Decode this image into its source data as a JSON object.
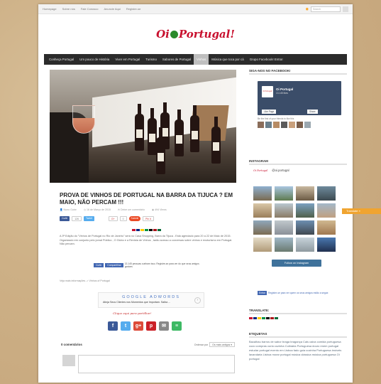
{
  "topbar": {
    "links": [
      "Homepage",
      "Sobre nós",
      "Fale Conosco",
      "Anuncie Aqui",
      "Registre-se"
    ],
    "search_placeholder": "Search"
  },
  "logo": {
    "text_left": "Oi",
    "text_right": "Portugal!"
  },
  "nav": {
    "items": [
      "Conheça Portugal",
      "Um pouco de História",
      "Viver em Portugal",
      "Turismo",
      "Sabores de Portugal",
      "Vinhos",
      "Música que toca por cá",
      "Grupo Facebook! Entra!"
    ],
    "active_index": 5
  },
  "article": {
    "title": "Prova de Vinhos de Portugal na Barra da Tijuca ? Em maio, não percam !!!",
    "author": "Nuno Gobe",
    "date": "16 de Março de 2015",
    "comments_link": "Deixe um comentário",
    "views": "494 Views",
    "share": {
      "fb": "Curtir",
      "fb_count": "126",
      "tweet": "Tweet",
      "gplus": "G+",
      "gplus_count": "0",
      "submit": "Submit",
      "pin": "Pin it"
    },
    "body": "A 3ª Edição do \"Vinhos de Portugal no Rio de Janeiro\" será no Casa Shopping, Barra da Tijuca - Está agendado para 20 a 22 de Maio de 2015. Organizado em conjunto pelo jornal Público , O Globo e a Revista de Vinhos , tarão acesso a conversas sobre vinhos e enoturismo em Portugal. Não percam.",
    "like_box": {
      "curtir": "Curtir",
      "compartilhar": "Compartilhar",
      "text": "13.145 pessoas curtiram isso. Registre-se para ver do que seus amigos gostam."
    },
    "see_more": "Veja mais informações -> Vinhos of Portugal",
    "ad": {
      "header": "GOOGLE ADWORDS",
      "text": "Atinja Seus Clientes nos Momentos que Importam. Saiba ..."
    },
    "share_hint": "Clique aqui para partilhar!",
    "comments": {
      "count": "0 comentários",
      "order_label": "Ordenar por",
      "order_value": "Os mais antigos"
    }
  },
  "sidebar": {
    "facebook": {
      "title": "Siga-nos no Facebook!",
      "page_name": "Oi Portugal",
      "likes": "13.145 likes",
      "like_page": "Like Page",
      "share": "Share",
      "friends_text": "Be the first of your friends to like this",
      "pic_text": "Oi Portugal!"
    },
    "instagram": {
      "title": "Instagram",
      "handle": "@oi.portugal",
      "logo": "Oi Portugal",
      "follow": "Follow on Instagram"
    },
    "fb_login": {
      "button": "Entrar",
      "text": "Registre-se para ver quem os seus amigos estão a seguir."
    },
    "translate": {
      "title": "Translate:"
    },
    "tags": {
      "title": "Etiquetas",
      "text": "Bacalhau barros de sabor braga bragança Cais caixa comida portuguesa cozo compras curia cozinha Culinária Portuguesa douro enem portugal estudar portugal evento em Lisboa fado guia cozinha Portuguesa imóveis lavandaria Lisboa morar portugal música clássica música portuguesa Oi portugal"
    }
  },
  "translate_tab": "Translate »",
  "colors": {
    "nav_bg": "#2b2b2b",
    "accent_red": "#c8102e",
    "facebook_blue": "#3b5998",
    "instagram_blue": "#3f729b",
    "translate_orange": "#f0a430"
  }
}
